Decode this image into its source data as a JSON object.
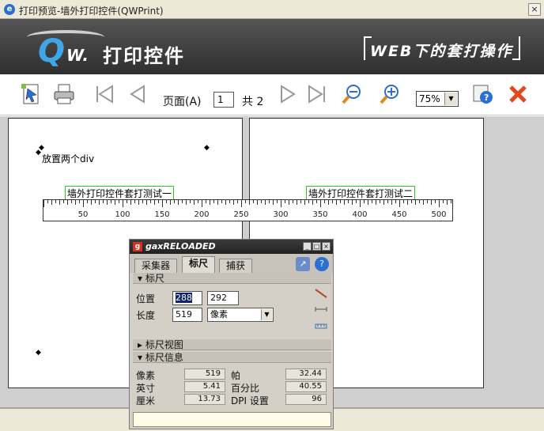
{
  "window": {
    "title": "打印预览-墙外打印控件(QWPrint)",
    "close_glyph": "×"
  },
  "banner": {
    "logo_q": "Q",
    "logo_w": "W.",
    "logo_text": "打印控件",
    "slogan": "WEB下的套打操作"
  },
  "toolbar": {
    "page_label": "页面(A)",
    "page_value": "1",
    "total_label": "共 2",
    "zoom_value": "75%",
    "zoom_arrow": "▼"
  },
  "preview": {
    "page1": {
      "marker_glyph": "◆",
      "text_div": "放置两个div",
      "box_div": "墙外打印控件套打测试一"
    },
    "page2": {
      "box_div": "墙外打印控件套打测试二"
    },
    "ruler": {
      "tick_labels": [
        "50",
        "100",
        "150",
        "200",
        "250",
        "300",
        "350",
        "400",
        "450",
        "500"
      ]
    }
  },
  "gax": {
    "title_prefix": "g",
    "title": "gaxRELOADED",
    "buttons": [
      "_",
      "□",
      "×"
    ],
    "tabs": [
      "采集器",
      "标尺",
      "捕获"
    ],
    "section_ruler": "▾ 标尺",
    "position_label": "位置",
    "position_value_1": "288",
    "position_value_2": "292",
    "length_label": "长度",
    "length_value": "519",
    "unit_value": "像素",
    "unit_arrow": "▼",
    "section_view": "▸ 标尺视图",
    "section_info": "▾ 标尺信息",
    "info": {
      "pixels_label": "像素",
      "pixels_value": "519",
      "pica_label": "帕",
      "pica_value": "32.44",
      "inch_label": "英寸",
      "inch_value": "5.41",
      "percent_label": "百分比",
      "percent_value": "40.55",
      "cm_label": "厘米",
      "cm_value": "13.73",
      "dpi_label": "DPI 设置",
      "dpi_value": "96"
    },
    "help_glyph": "?",
    "export_glyph": "↗"
  }
}
